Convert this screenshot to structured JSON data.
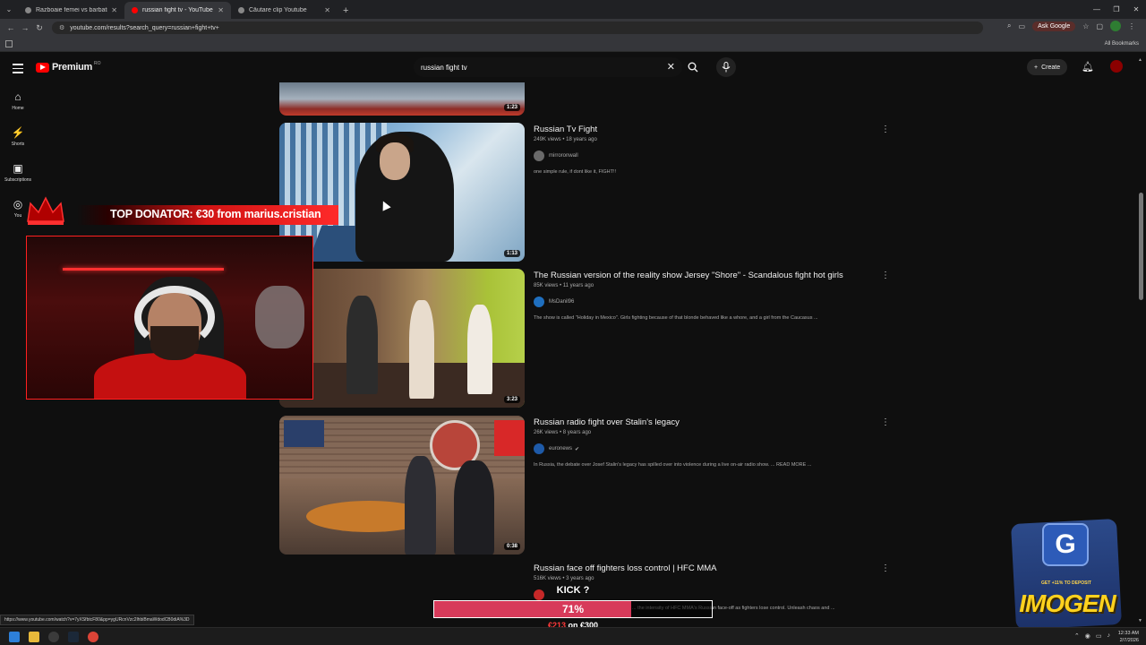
{
  "browser": {
    "tabs": [
      {
        "label": "Razboaie femei vs barbati",
        "active": false
      },
      {
        "label": "russian fight tv - YouTube",
        "active": true
      },
      {
        "label": "Căutare clip Youtube",
        "active": false
      }
    ],
    "url": "youtube.com/results?search_query=russian+fight+tv+",
    "ask_google": "Ask Google",
    "all_bookmarks": "All Bookmarks",
    "status_url": "https://www.youtube.com/watch?v=7yXSfbtcF80&pp=ygURcnVzc2lhbiBmaWdodCB0diA%3D"
  },
  "youtube": {
    "logo_text": "Premium",
    "country_code": "RO",
    "search_value": "russian fight tv",
    "create_label": "Create",
    "guide": [
      {
        "label": "Home",
        "icon": "home-icon"
      },
      {
        "label": "Shorts",
        "icon": "shorts-icon"
      },
      {
        "label": "Subscriptions",
        "icon": "subscriptions-icon"
      },
      {
        "label": "You",
        "icon": "you-icon"
      }
    ],
    "top_duration": "1:23",
    "results": [
      {
        "title": "Russian Tv Fight",
        "meta": "249K views • 18 years ago",
        "channel": "mirroronwall",
        "verified": false,
        "description": "one simple rule, if dont like it, FIGHT!!",
        "duration": "1:13",
        "channel_color": "#6a6a6a"
      },
      {
        "title": "The Russian version of the reality show Jersey \"Shore\" - Scandalous fight hot girls",
        "meta": "85K views • 11 years ago",
        "channel": "MsDanil96",
        "verified": false,
        "description": "The show is called \"Holiday in Mexico\". Girls fighting because of that blonde behaved like a whore, and a girl from the Caucasus ...",
        "duration": "3:23",
        "channel_color": "#1f6fbf"
      },
      {
        "title": "Russian radio fight over Stalin's legacy",
        "meta": "26K views • 8 years ago",
        "channel": "euronews",
        "verified": true,
        "description": "In Russia, the debate over Josef Stalin's legacy has spilled over into violence during a live on-air radio show. ... READ MORE ...",
        "duration": "0:38",
        "channel_color": "#1e5aa8"
      },
      {
        "title": "Russian face off fighters loss control | HFC MMA",
        "meta": "516K views • 3 years ago",
        "channel": "",
        "verified": false,
        "description": "... the intensity of HFC MMA's Russian face-off as fighters lose control. Unleash chaos and ...",
        "duration": "",
        "channel_color": "#c62828"
      }
    ]
  },
  "overlay": {
    "donator": "TOP DONATOR: €30 from marius.cristian",
    "kick_label": "KICK ?",
    "kick_percent": "71%",
    "kick_fraction": 0.71,
    "kick_current": "€213",
    "kick_on": "on",
    "kick_goal": "€300",
    "promo_deposit": "GET +11% TO DEPOSIT",
    "promo_brand": "IMOGEN",
    "promo_badge": "G"
  },
  "taskbar": {
    "time": "12:33 AM",
    "date": "2/7/2026"
  }
}
